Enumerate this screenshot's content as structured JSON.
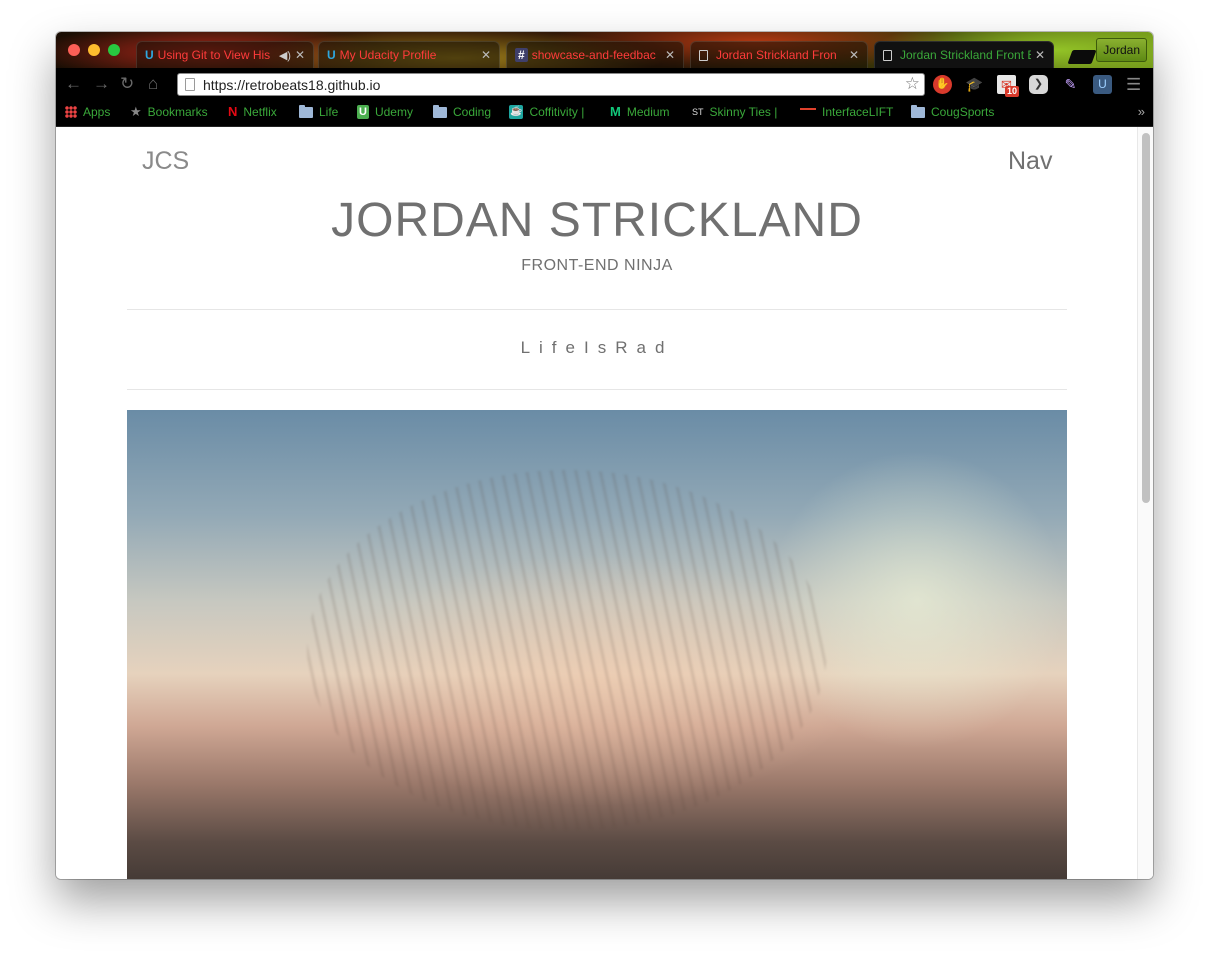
{
  "browser": {
    "tabs": [
      {
        "title": "Using Git to View His",
        "favicon": "udacity-icon",
        "color": "#ff3b3b",
        "has_audio": true
      },
      {
        "title": "My Udacity Profile",
        "favicon": "udacity-icon",
        "color": "#ff3b3b"
      },
      {
        "title": "showcase-and-feedbac",
        "favicon": "hash-icon",
        "color": "#ff3b3b"
      },
      {
        "title": "Jordan Strickland Fron",
        "favicon": "document-icon",
        "color": "#ff3b3b"
      },
      {
        "title": "Jordan Strickland Front E",
        "favicon": "document-icon",
        "color": "#3aa83a",
        "active": true
      }
    ],
    "profile_name": "Jordan",
    "address_bar": {
      "url": "https://retrobeats18.github.io"
    },
    "extensions": {
      "mail_badge": "10"
    },
    "bookmarks": [
      {
        "label": "Apps",
        "icon": "apps-grid-icon"
      },
      {
        "label": "Bookmarks",
        "icon": "star-icon"
      },
      {
        "label": "Netflix",
        "icon": "netflix-icon"
      },
      {
        "label": "Life",
        "icon": "folder-icon"
      },
      {
        "label": "Udemy",
        "icon": "udemy-icon"
      },
      {
        "label": "Coding",
        "icon": "folder-icon"
      },
      {
        "label": "Coffitivity |",
        "icon": "coffitivity-icon"
      },
      {
        "label": "Medium",
        "icon": "medium-icon"
      },
      {
        "label": "Skinny Ties |",
        "icon": "st-icon",
        "icon_text": "ST"
      },
      {
        "label": "InterfaceLIFT",
        "icon": "interfacelift-icon"
      },
      {
        "label": "CougSports",
        "icon": "folder-icon"
      }
    ],
    "bookmarks_overflow": "»",
    "colors": {
      "bookmark_text": "#3aa83a",
      "tab_inactive_text": "#ff3b3b"
    }
  },
  "page": {
    "logo": "JCS",
    "nav_label": "Nav",
    "title": "JORDAN STRICKLAND",
    "subtitle": "FRONT-END NINJA",
    "motto": "LifeIsRad",
    "text_color": "#707070"
  }
}
